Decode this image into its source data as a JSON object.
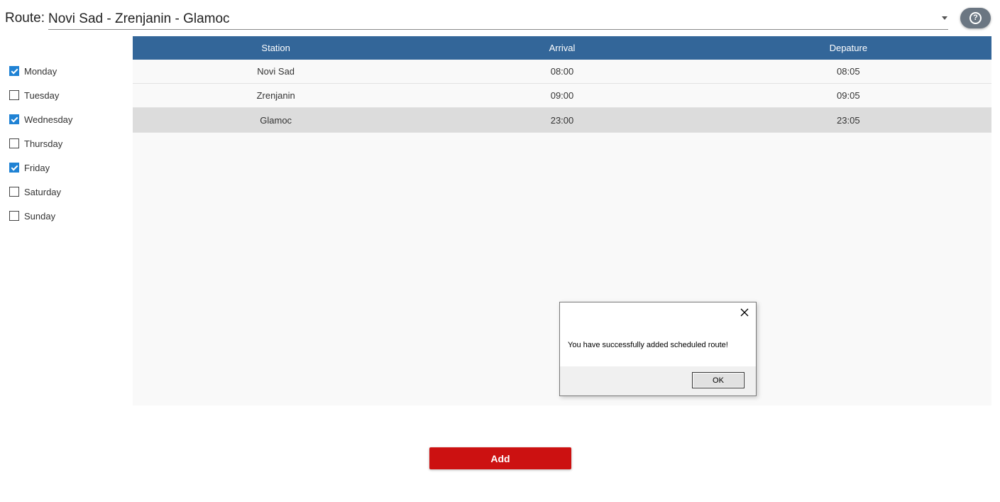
{
  "route": {
    "label": "Route:",
    "value": "Novi Sad - Zrenjanin - Glamoc"
  },
  "help": {
    "icon": "question-circle-icon"
  },
  "days": [
    {
      "label": "Monday",
      "checked": true
    },
    {
      "label": "Tuesday",
      "checked": false
    },
    {
      "label": "Wednesday",
      "checked": true
    },
    {
      "label": "Thursday",
      "checked": false
    },
    {
      "label": "Friday",
      "checked": true
    },
    {
      "label": "Saturday",
      "checked": false
    },
    {
      "label": "Sunday",
      "checked": false
    }
  ],
  "table": {
    "columns": [
      "Station",
      "Arrival",
      "Depature"
    ],
    "rows": [
      {
        "station": "Novi Sad",
        "arrival": "08:00",
        "departure": "08:05"
      },
      {
        "station": "Zrenjanin",
        "arrival": "09:00",
        "departure": "09:05"
      },
      {
        "station": "Glamoc",
        "arrival": "23:00",
        "departure": "23:05"
      }
    ],
    "header_color": "#336699",
    "selected_row_color": "#dcdcdc"
  },
  "dialog": {
    "message": "You have successfully added scheduled route!",
    "ok_label": "OK",
    "close_icon": "close-icon"
  },
  "add_button": {
    "label": "Add",
    "color": "#cc1111"
  },
  "accent_color": "#1f82d4"
}
